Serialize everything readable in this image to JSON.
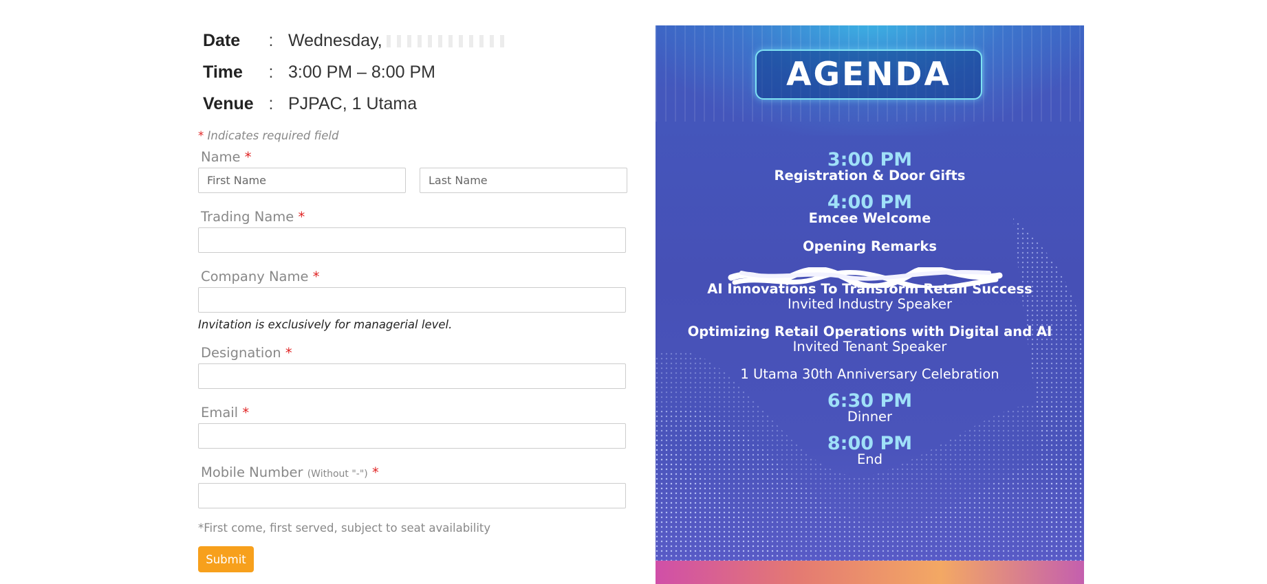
{
  "event": {
    "date_label": "Date",
    "date_value": "Wednesday,",
    "time_label": "Time",
    "time_value": "3:00 PM – 8:00 PM",
    "venue_label": "Venue",
    "venue_value": "PJPAC, 1 Utama",
    "colon": ":"
  },
  "form": {
    "required_note_star": "*",
    "required_note": " Indicates required field",
    "required_star": "*",
    "name_label": "Name",
    "first_name_placeholder": "First Name",
    "last_name_placeholder": "Last Name",
    "trading_name_label": "Trading Name",
    "company_name_label": "Company Name",
    "invitation_note": "Invitation is exclusively for managerial level.",
    "designation_label": "Designation",
    "email_label": "Email",
    "mobile_label": "Mobile Number",
    "mobile_hint": "(Without \"-\")",
    "seat_note": "*First come, first served, subject to seat availability",
    "submit_label": "Submit"
  },
  "agenda": {
    "title": "AGENDA",
    "items": [
      {
        "time": "3:00 PM",
        "text": "Registration & Door Gifts"
      },
      {
        "time": "4:00 PM",
        "text": "Emcee Welcome"
      },
      {
        "text": "Opening Remarks"
      },
      {
        "text": "AI Innovations To Transform Retail Success",
        "sub": "Invited Industry Speaker"
      },
      {
        "text": "Optimizing Retail Operations with Digital and AI",
        "sub": "Invited Tenant Speaker"
      },
      {
        "text": "1 Utama 30th Anniversary Celebration"
      },
      {
        "time": "6:30 PM",
        "text": "Dinner"
      },
      {
        "time": "8:00 PM",
        "text": "End"
      }
    ]
  },
  "colors": {
    "submit": "#f7a01c",
    "required_star": "#e02424",
    "agenda_time": "#9fe0f8",
    "poster_bg": "#4650b6"
  }
}
